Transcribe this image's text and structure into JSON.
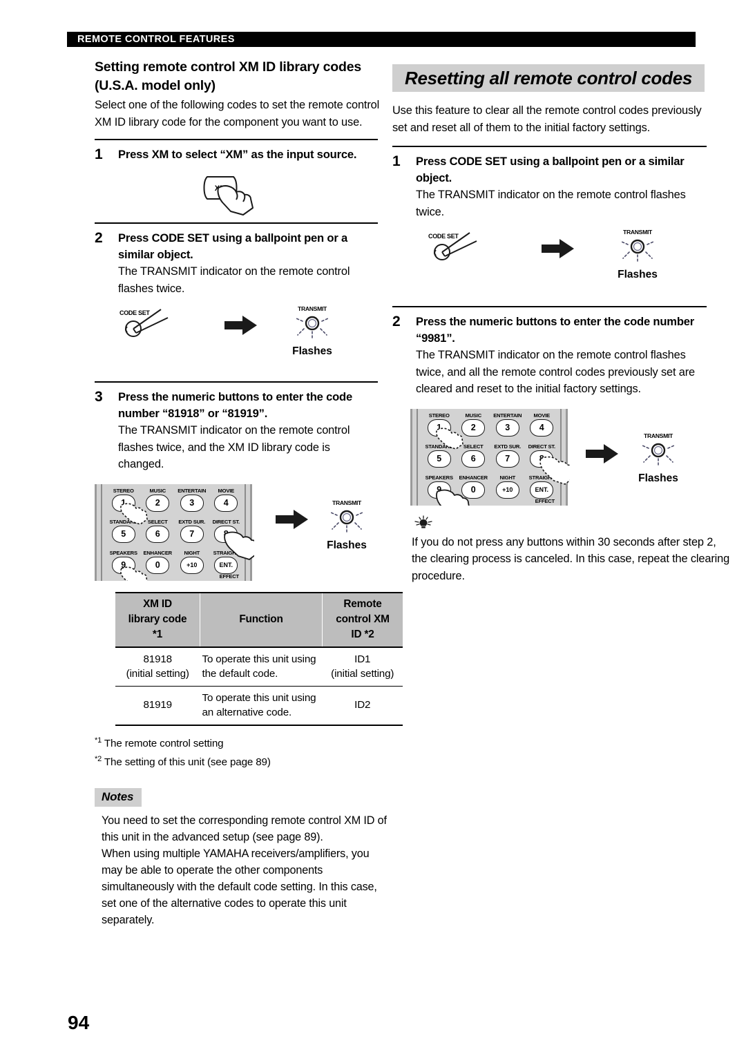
{
  "page": {
    "running_header": "REMOTE CONTROL FEATURES",
    "page_number": "94"
  },
  "left_column": {
    "title": "Setting remote control XM ID library codes (U.S.A. model only)",
    "intro": "Select one of the following codes to set the remote control XM ID library code for the component you want to use.",
    "steps": [
      {
        "number": "1",
        "heading": "Press XM to select “XM” as the input source.",
        "description": "",
        "figure": {
          "type": "xm-button",
          "button_label": "XM"
        }
      },
      {
        "number": "2",
        "heading": "Press CODE SET using a ballpoint pen or a similar object.",
        "description": "The TRANSMIT indicator on the remote control flashes twice.",
        "figure": {
          "type": "codeset-to-transmit",
          "codeset_label": "CODE SET",
          "transmit_label": "TRANSMIT",
          "flashes_label": "Flashes"
        }
      },
      {
        "number": "3",
        "heading": "Press the numeric buttons to enter the code number “81918” or “81919”.",
        "description": "The TRANSMIT indicator on the remote control flashes twice, and the XM ID library code is changed.",
        "figure": {
          "type": "keypad-to-transmit",
          "transmit_label": "TRANSMIT",
          "flashes_label": "Flashes"
        }
      }
    ],
    "table": {
      "headers": [
        "XM ID\nlibrary code\n*1",
        "Function",
        "Remote\ncontrol XM\nID *2"
      ],
      "header_lines": [
        [
          "XM ID",
          "library code",
          "*1"
        ],
        [
          "Function"
        ],
        [
          "Remote",
          "control XM",
          "ID *2"
        ]
      ],
      "rows": [
        {
          "code": [
            "81918",
            "(initial setting)"
          ],
          "function": [
            "To operate this unit using",
            "the default code."
          ],
          "id": [
            "ID1",
            "(initial setting)"
          ]
        },
        {
          "code": [
            "81919"
          ],
          "function": [
            "To operate this unit using",
            "an alternative code."
          ],
          "id": [
            "ID2"
          ]
        }
      ]
    },
    "footnotes": [
      {
        "marker": "*1",
        "text": "The remote control setting"
      },
      {
        "marker": "*2",
        "text": "The setting of this unit (see page 89)"
      }
    ],
    "notes": {
      "badge": "Notes",
      "items": [
        "You need to set the corresponding remote control XM ID of this unit in the advanced setup (see page 89).",
        "When using multiple YAMAHA receivers/amplifiers, you may be able to operate the other components simultaneously with the default code setting. In this case, set one of the alternative codes to operate this unit separately."
      ]
    }
  },
  "right_column": {
    "title": "Resetting all remote control codes",
    "intro": "Use this feature to clear all the remote control codes previously set and reset all of them to the initial factory settings.",
    "steps": [
      {
        "number": "1",
        "heading": "Press CODE SET using a ballpoint pen or a similar object.",
        "description": "The TRANSMIT indicator on the remote control flashes twice.",
        "figure": {
          "type": "codeset-to-transmit",
          "codeset_label": "CODE SET",
          "transmit_label": "TRANSMIT",
          "flashes_label": "Flashes"
        }
      },
      {
        "number": "2",
        "heading": "Press the numeric buttons to enter the code number “9981”.",
        "description": "The TRANSMIT indicator on the remote control flashes twice, and all the remote control codes previously set are cleared and reset to the initial factory settings.",
        "figure": {
          "type": "keypad-to-transmit",
          "transmit_label": "TRANSMIT",
          "flashes_label": "Flashes"
        }
      }
    ],
    "tip": {
      "icon": "lightbulb-tip-icon",
      "text": "If you do not press any buttons within 30 seconds after step 2, the clearing process is canceled. In this case, repeat the clearing procedure."
    }
  },
  "keypad": {
    "buttons": [
      {
        "function": "STEREO",
        "key": "1"
      },
      {
        "function": "MUSIC",
        "key": "2"
      },
      {
        "function": "ENTERTAIN",
        "key": "3"
      },
      {
        "function": "MOVIE",
        "key": "4"
      },
      {
        "function": "STANDARD",
        "key": "5"
      },
      {
        "function": "SELECT",
        "key": "6"
      },
      {
        "function": "EXTD SUR.",
        "key": "7"
      },
      {
        "function": "DIRECT ST.",
        "key": "8"
      },
      {
        "function": "SPEAKERS",
        "key": "9"
      },
      {
        "function": "ENHANCER",
        "key": "0"
      },
      {
        "function": "NIGHT",
        "key": "+10"
      },
      {
        "function": "STRAIGHT",
        "key": "ENT."
      }
    ],
    "effect_label": "EFFECT"
  },
  "colors": {
    "header_bar": "#000000",
    "band_gray": "#cfcfcf",
    "table_header_gray": "#bdbdbd",
    "keypad_gray": "#d3d3d3"
  }
}
